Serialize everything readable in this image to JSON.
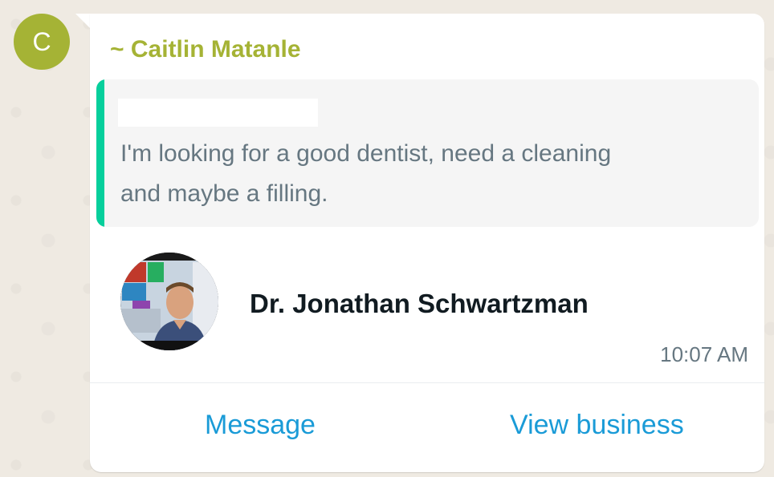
{
  "avatar": {
    "initial": "C",
    "color": "#a5b335"
  },
  "message": {
    "sender": "~ Caitlin Matanle",
    "quoted_text": "I'm looking for a good dentist, need a cleaning and maybe a filling.",
    "contact_name": "Dr. Jonathan Schwartzman",
    "contact_photo_icon": "dentist-photo",
    "time": "10:07 AM"
  },
  "actions": {
    "message_label": "Message",
    "view_business_label": "View business"
  },
  "colors": {
    "accent": "#06cf9c",
    "link": "#1a9bd7",
    "sender": "#a5b335"
  }
}
